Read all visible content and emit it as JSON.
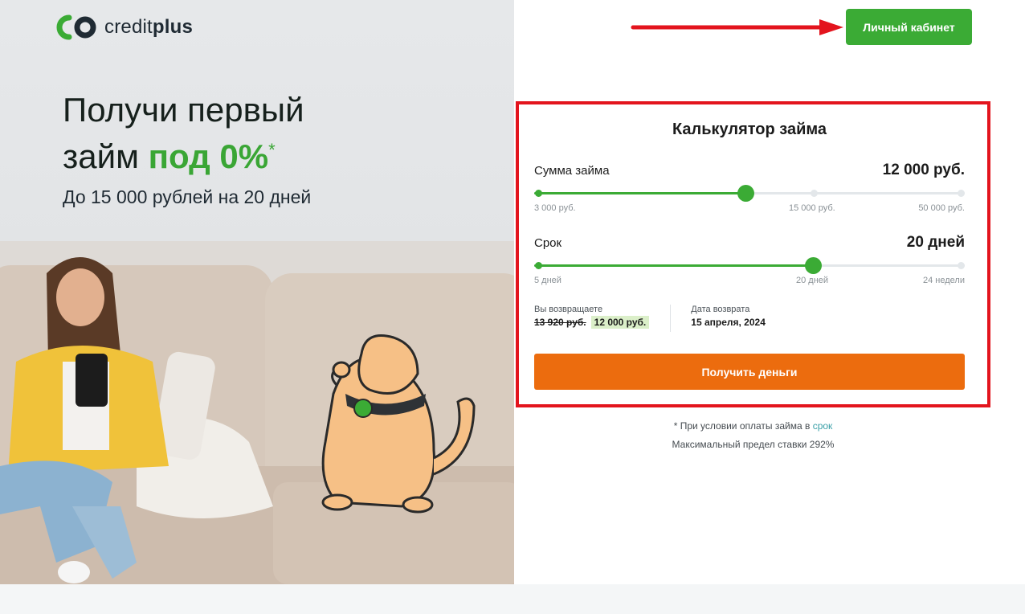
{
  "logo": {
    "text_light": "credit",
    "text_bold": "plus"
  },
  "hero": {
    "title_line1": "Получи первый",
    "title_line2_plain": "займ ",
    "title_line2_green": "под 0%",
    "title_asterisk": "*",
    "subtitle": "До 15 000 рублей на 20 дней"
  },
  "header": {
    "cabinet_label": "Личный кабинет"
  },
  "calculator": {
    "title": "Калькулятор займа",
    "amount": {
      "label": "Сумма займа",
      "value": "12 000 руб.",
      "ticks": [
        "3 000 руб.",
        "15 000 руб.",
        "50 000 руб."
      ],
      "position_fraction": 0.49
    },
    "term": {
      "label": "Срок",
      "value": "20 дней",
      "ticks": [
        "5 дней",
        "20 дней",
        "24 недели"
      ],
      "position_fraction": 0.65
    },
    "return": {
      "label": "Вы возвращаете",
      "old_amount": "13 920 руб.",
      "new_amount": "12 000 руб."
    },
    "return_date": {
      "label": "Дата возврата",
      "value": "15 апреля, 2024"
    },
    "submit_label": "Получить деньги"
  },
  "notes": {
    "condition_prefix": "* При условии оплаты займа в ",
    "condition_link": "срок",
    "max_rate": "Максимальный предел ставки 292%"
  },
  "colors": {
    "brand_green": "#3bab35",
    "cta_orange": "#ec6c0e",
    "highlight_red": "#e3141d"
  }
}
